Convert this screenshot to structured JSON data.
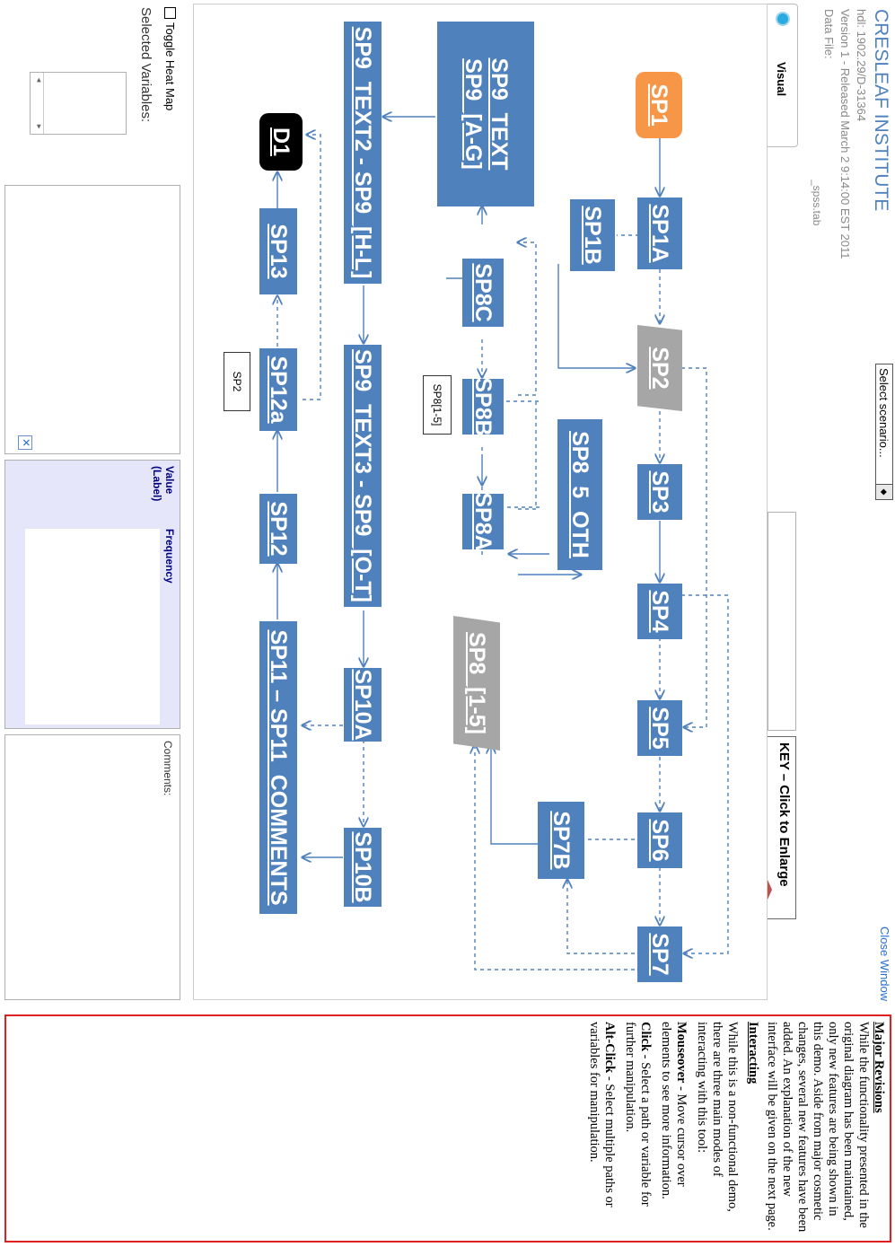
{
  "header": {
    "institute": "CRESLEAF INSTITUTE",
    "hdl": "hdl: 1902.29/D-31364",
    "version": "Version 1 - Released March 2 9:14:00 EST 2011",
    "data_file_label": "Data File:",
    "data_file_value": "_spss.tab",
    "select_scenario": "Select scenario...",
    "visual_tab": "Visual",
    "close_window": "Close Window"
  },
  "key": {
    "title": "KEY – Click to Enlarge"
  },
  "diagram": {
    "nodes": {
      "sp1": "SP1",
      "sp1a": "SP1A",
      "sp1b": "SP1B",
      "sp2": "SP2",
      "sp3": "SP3",
      "sp4": "SP4",
      "sp5": "SP5",
      "sp6": "SP6",
      "sp7": "SP7",
      "sp7b": "SP7B",
      "sp8_5_oth": "SP8_5_OTH",
      "sp8a": "SP8A",
      "sp8b": "SP8B",
      "sp8c": "SP8C",
      "sp8_1_5": "SP8_[1-5]",
      "sp9_text_line1": "SP9_TEXT",
      "sp9_text_line2": "SP9_[A-G]",
      "sp9_text2": "SP9_TEXT2 - SP9_[H-L]",
      "sp9_text3": "SP9_TEXT3 - SP9_[O-T]",
      "sp10a": "SP10A",
      "sp10b": "SP10B",
      "sp11": "SP11 – SP11_COMMENTS",
      "sp12": "SP12",
      "sp12a": "SP12a",
      "sp13": "SP13",
      "d1": "D1"
    },
    "tags": {
      "sp8_tag": "SP8[1-5]",
      "sp2_tag": "SP2"
    }
  },
  "bottom": {
    "toggle_heat_map": "Toggle Heat Map",
    "selected_variables": "Selected Variables:",
    "value_label": "Value (Label)",
    "frequency": "Frequency",
    "comments": "Comments:"
  },
  "notes": {
    "major_title": "Major Revisions",
    "major_body": "While the functionality presented in the original diagram has been maintained, only new features are being shown in this demo. Aside from major cosmetic changes, several new features have been added. An explanation of the new interface will be given on the next page.",
    "interacting_title": "Interacting",
    "interacting_body": "While this is a non-functional demo, there are three main modes of interacting with this tool:",
    "mouseover_label": "Mouseover",
    "mouseover_body": " - Move cursor over elements to see more information.",
    "click_label": "Click",
    "click_body": " - Select a path or variable for further manipulation.",
    "altclick_label": "Alt-Click",
    "altclick_body": " - Select multiple paths or variables for manipulation."
  },
  "colors": {
    "node_blue": "#4f81bd",
    "start_orange": "#f79646",
    "end_black": "#000000",
    "decision_gray": "#a6a6a6",
    "heading_blue": "#4f81bd",
    "highlight_red": "#e02020",
    "table_header": "#e6e6fa"
  }
}
